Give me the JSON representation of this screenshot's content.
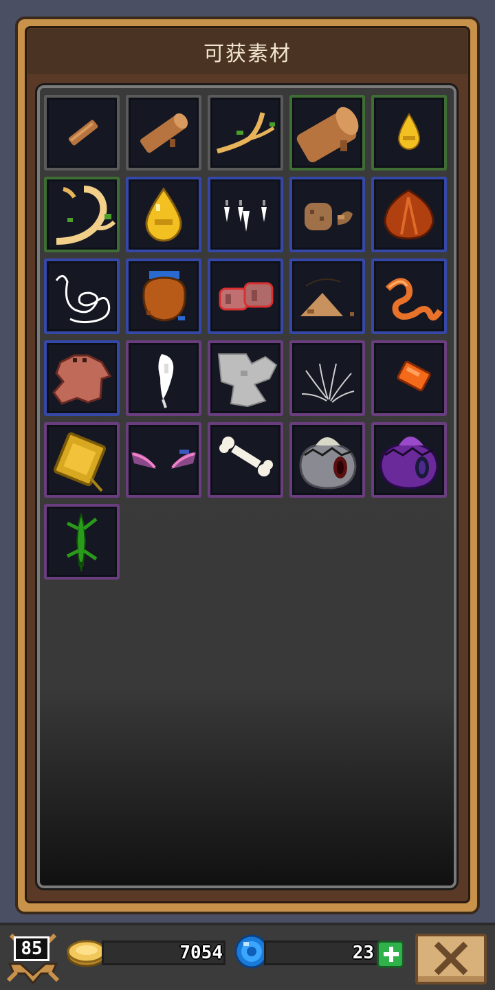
{
  "title": "可获素材",
  "player": {
    "level": "85"
  },
  "currency": {
    "gold": "7054",
    "gems": "23"
  },
  "colors": {
    "rarity_gray": "#5b5b5b",
    "rarity_green": "#3f6e34",
    "rarity_blue": "#3548a8",
    "rarity_purple": "#6a3d7e",
    "panel_gold": "#c8924a"
  },
  "materials": [
    {
      "icon": "thin-branch-icon",
      "rarity": "gray"
    },
    {
      "icon": "log-icon",
      "rarity": "gray"
    },
    {
      "icon": "twig-icon",
      "rarity": "gray"
    },
    {
      "icon": "large-log-icon",
      "rarity": "green"
    },
    {
      "icon": "sap-drop-small-icon",
      "rarity": "green"
    },
    {
      "icon": "golden-root-icon",
      "rarity": "green"
    },
    {
      "icon": "sap-drop-large-icon",
      "rarity": "blue"
    },
    {
      "icon": "fangs-icon",
      "rarity": "blue"
    },
    {
      "icon": "mushroom-clump-icon",
      "rarity": "blue"
    },
    {
      "icon": "chestnut-icon",
      "rarity": "blue"
    },
    {
      "icon": "silk-thread-icon",
      "rarity": "blue"
    },
    {
      "icon": "clay-pot-icon",
      "rarity": "blue"
    },
    {
      "icon": "raw-meat-icon",
      "rarity": "blue"
    },
    {
      "icon": "dirt-pile-icon",
      "rarity": "blue"
    },
    {
      "icon": "worm-icon",
      "rarity": "blue"
    },
    {
      "icon": "animal-pelt-icon",
      "rarity": "blue"
    },
    {
      "icon": "white-feather-icon",
      "rarity": "purple"
    },
    {
      "icon": "gray-pelt-icon",
      "rarity": "purple"
    },
    {
      "icon": "whiskers-icon",
      "rarity": "purple"
    },
    {
      "icon": "orange-gem-icon",
      "rarity": "purple"
    },
    {
      "icon": "golden-scale-icon",
      "rarity": "purple"
    },
    {
      "icon": "bat-wings-icon",
      "rarity": "purple"
    },
    {
      "icon": "bone-icon",
      "rarity": "purple"
    },
    {
      "icon": "gray-egg-icon",
      "rarity": "purple"
    },
    {
      "icon": "purple-egg-icon",
      "rarity": "purple"
    },
    {
      "icon": "lizard-icon",
      "rarity": "purple"
    }
  ]
}
